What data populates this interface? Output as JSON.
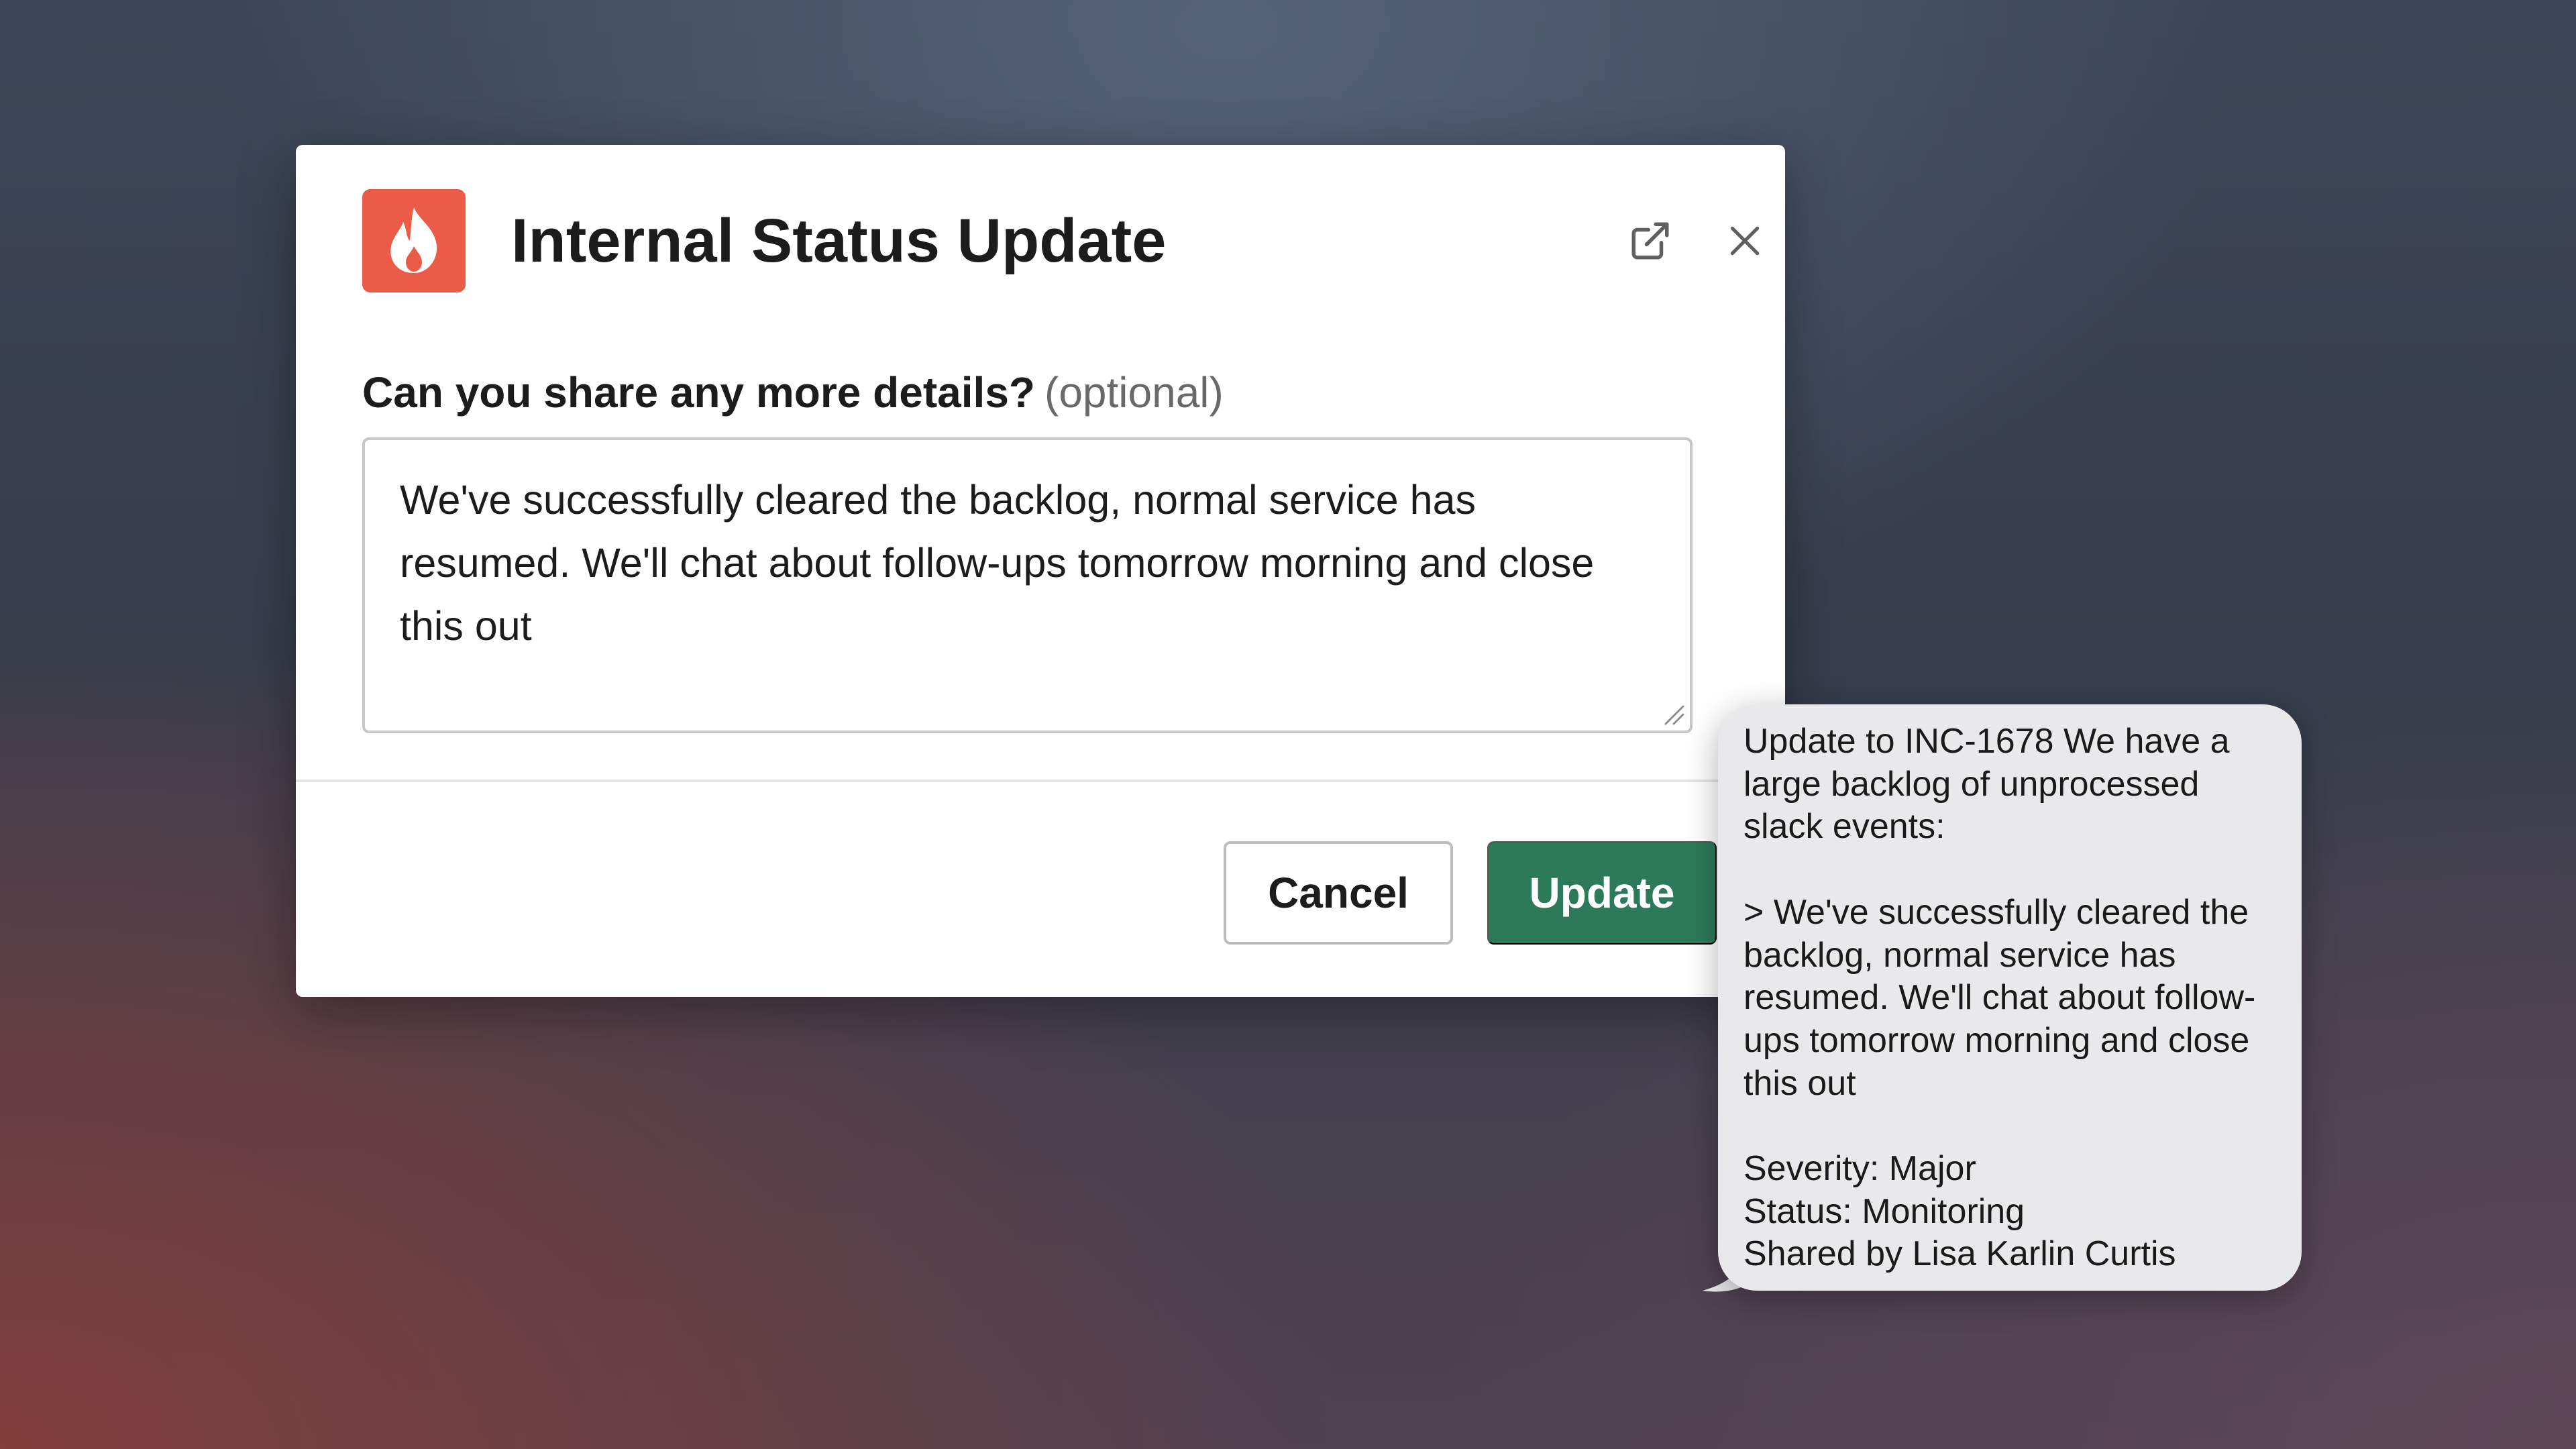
{
  "modal": {
    "title": "Internal Status Update",
    "icon": "flame-icon",
    "brand_color": "#eb5c48",
    "field_label": "Can you share any more details?",
    "field_optional": "(optional)",
    "textarea_value": "We've successfully cleared the backlog, normal service has resumed. We'll chat about follow-ups tomorrow morning and close this out",
    "cancel_label": "Cancel",
    "update_label": "Update",
    "update_color": "#2d7a5b"
  },
  "message": {
    "intro": "Update to INC-1678 We have a large backlog of unprocessed slack events:",
    "quote": "> We've successfully cleared the backlog, normal service has resumed. We'll chat about follow-ups tomorrow morning and close this out",
    "severity": "Severity: Major",
    "status": "Status: Monitoring",
    "shared_by": "Shared by Lisa Karlin Curtis"
  }
}
